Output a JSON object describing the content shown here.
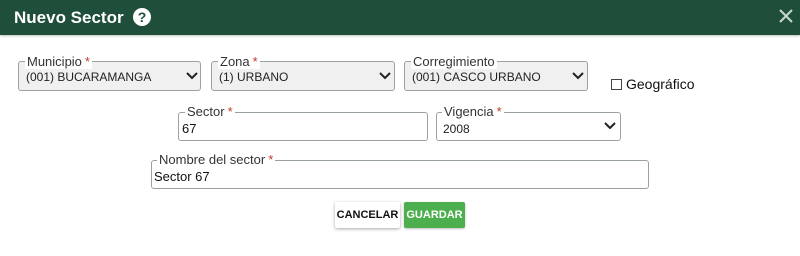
{
  "dialog": {
    "title": "Nuevo Sector",
    "help_icon": "question-circle-icon",
    "close_icon": "close-icon"
  },
  "form": {
    "municipio": {
      "label": "Municipio",
      "required": "*",
      "value": "(001) BUCARAMANGA"
    },
    "zona": {
      "label": "Zona",
      "required": "*",
      "value": "(1) URBANO"
    },
    "corregimiento": {
      "label": "Corregimiento",
      "value": "(001) CASCO URBANO"
    },
    "geografico": {
      "label": "Geográfico",
      "checked": false
    },
    "sector": {
      "label": "Sector",
      "required": "*",
      "value": "67"
    },
    "vigencia": {
      "label": "Vigencia",
      "required": "*",
      "value": "2008"
    },
    "nombre_sector": {
      "label": "Nombre del sector",
      "required": "*",
      "value": "Sector 67"
    }
  },
  "actions": {
    "cancel_label": "CANCELAR",
    "save_label": "GUARDAR"
  },
  "colors": {
    "header": "#1f4f3a",
    "save_button": "#4cae4c",
    "required_mark": "#c0392b"
  }
}
